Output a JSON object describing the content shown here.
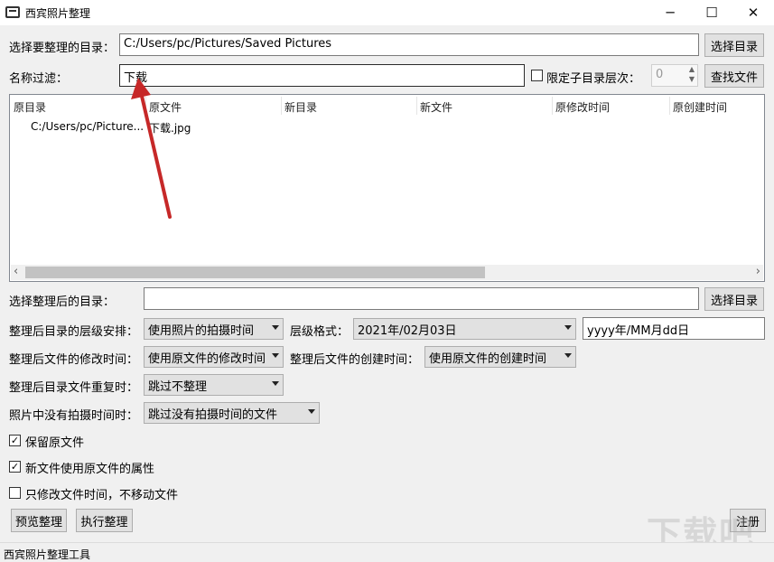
{
  "window": {
    "title": "西宾照片整理",
    "controls": [
      "─",
      "☐",
      "✕"
    ]
  },
  "source_dir": {
    "label": "选择要整理的目录：",
    "value": "C:/Users/pc/Pictures/Saved Pictures",
    "button": "选择目录"
  },
  "filter": {
    "label": "名称过滤：",
    "value": "下载",
    "limit_label": "限定子目录层次：",
    "limit_checked": false,
    "depth_value": "0",
    "find_button": "查找文件"
  },
  "table": {
    "columns": [
      "原目录",
      "原文件",
      "新目录",
      "新文件",
      "原修改时间",
      "原创建时间"
    ],
    "rows": [
      {
        "src_dir": "C:/Users/pc/Picture...",
        "src_file": "下载.jpg",
        "new_dir": "",
        "new_file": "",
        "mod_time": "",
        "create_time": ""
      }
    ],
    "scroll_left": "‹",
    "scroll_right": "›"
  },
  "target_dir": {
    "label": "选择整理后的目录：",
    "value": "",
    "button": "选择目录"
  },
  "hierarchy": {
    "label": "整理后目录的层级安排：",
    "value": "使用照片的拍摄时间",
    "format_label": "层级格式：",
    "format_value": "2021年/02月03日",
    "format_pattern": "yyyy年/MM月dd日"
  },
  "mod_time_opt": {
    "label": "整理后文件的修改时间：",
    "value": "使用原文件的修改时间",
    "create_label": "整理后文件的创建时间：",
    "create_value": "使用原文件的创建时间"
  },
  "duplicate": {
    "label": "整理后目录文件重复时：",
    "value": "跳过不整理"
  },
  "no_shoot_time": {
    "label": "照片中没有拍摄时间时：",
    "value": "跳过没有拍摄时间的文件"
  },
  "options": [
    {
      "label": "保留原文件",
      "checked": true
    },
    {
      "label": "新文件使用原文件的属性",
      "checked": true
    },
    {
      "label": "只修改文件时间，不移动文件",
      "checked": false
    }
  ],
  "buttons": {
    "preview": "预览整理",
    "execute": "执行整理",
    "register": "注册"
  },
  "watermark": "下载吧",
  "status": "西宾照片整理工具"
}
